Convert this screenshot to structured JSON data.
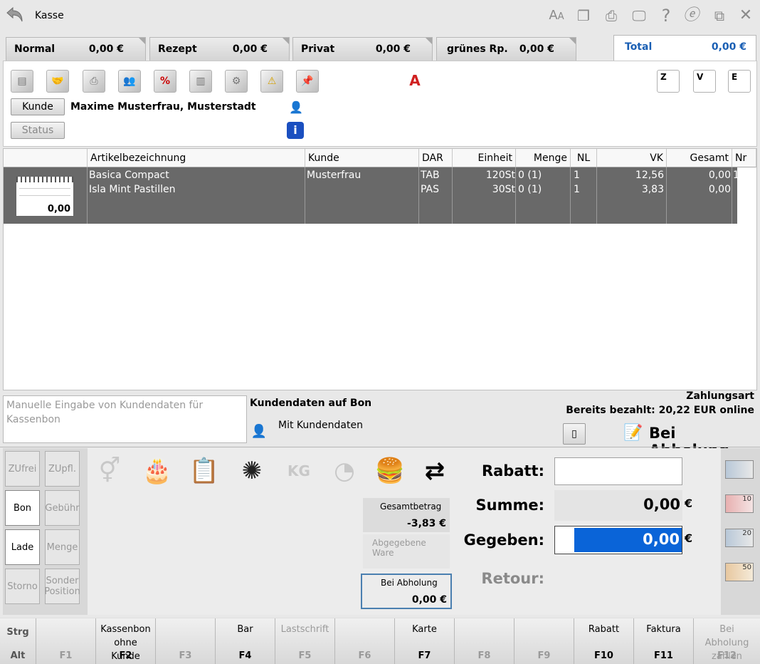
{
  "window": {
    "title": "Kasse"
  },
  "tabs": [
    {
      "label": "Normal",
      "value": "0,00 €"
    },
    {
      "label": "Rezept",
      "value": "0,00 €"
    },
    {
      "label": "Privat",
      "value": "0,00 €"
    },
    {
      "label": "grünes Rp.",
      "value": "0,00 €"
    },
    {
      "label": "Total",
      "value": "0,00 €"
    }
  ],
  "header": {
    "kunde_button": "Kunde",
    "customer_name": "Maxime Musterfrau, Musterstadt",
    "status_button": "Status",
    "right_icons": [
      "Z",
      "V",
      "E"
    ]
  },
  "table": {
    "columns": [
      "Artikelbezeichnung",
      "Kunde",
      "DAR",
      "Einheit",
      "Menge",
      "NL",
      "VK",
      "Gesamt",
      "Nr"
    ],
    "pad_value": "0,00",
    "rows": [
      {
        "name": "Basica Compact",
        "kunde": "Musterfrau",
        "dar": "TAB",
        "einheit": "120St",
        "menge": "0 (1)",
        "nl": "1",
        "vk": "12,56",
        "gesamt": "0,00",
        "nr": "1"
      },
      {
        "name": "Isla Mint Pastillen",
        "kunde": "",
        "dar": "PAS",
        "einheit": "30St",
        "menge": "0 (1)",
        "nl": "1",
        "vk": "3,83",
        "gesamt": "0,00",
        "nr": ""
      }
    ]
  },
  "customer_data": {
    "placeholder": "Manuelle Eingabe von Kundendaten für Kassenbon",
    "heading": "Kundendaten auf Bon",
    "option": "Mit Kundendaten"
  },
  "payment": {
    "heading": "Zahlungsart",
    "paid_info": "Bereits bezahlt: 20,22 EUR online",
    "method": "Bei Abholung"
  },
  "side_buttons": [
    {
      "label": "ZUfrei",
      "active": false
    },
    {
      "label": "ZUpfl.",
      "active": false
    },
    {
      "label": "Bon",
      "active": true
    },
    {
      "label": "Gebühr",
      "active": false
    },
    {
      "label": "Lade",
      "active": true
    },
    {
      "label": "Menge",
      "active": false
    },
    {
      "label": "Storno",
      "active": false
    },
    {
      "label": "Sonder Position",
      "active": false
    }
  ],
  "totals_boxes": {
    "gesamtbetrag_label": "Gesamtbetrag",
    "gesamtbetrag_value": "-3,83 €",
    "abgegeben_label": "Abgegebene Ware",
    "abholung_label": "Bei Abholung",
    "abholung_value": "0,00 €"
  },
  "summary": {
    "rabatt_label": "Rabatt:",
    "summe_label": "Summe:",
    "summe_value": "0,00",
    "gegeben_label": "Gegeben:",
    "gegeben_value": "0,00",
    "retour_label": "Retour:",
    "currency": "€"
  },
  "money_buttons": [
    "",
    "10",
    "20",
    "50"
  ],
  "function_keys": {
    "strg": "Strg",
    "alt": "Alt",
    "keys": [
      {
        "key": "F1",
        "label": "",
        "enabled": false
      },
      {
        "key": "F2",
        "label": "Kassenbon ohne Kunde",
        "enabled": true
      },
      {
        "key": "F3",
        "label": "",
        "enabled": false
      },
      {
        "key": "F4",
        "label": "Bar",
        "enabled": true
      },
      {
        "key": "F5",
        "label": "Lastschrift",
        "enabled": false
      },
      {
        "key": "F6",
        "label": "",
        "enabled": false
      },
      {
        "key": "F7",
        "label": "Karte",
        "enabled": true
      },
      {
        "key": "F8",
        "label": "",
        "enabled": false
      },
      {
        "key": "F9",
        "label": "",
        "enabled": false
      },
      {
        "key": "F10",
        "label": "Rabatt",
        "enabled": true
      },
      {
        "key": "F11",
        "label": "Faktura",
        "enabled": true
      },
      {
        "key": "F12",
        "label": "Bei Abholung zahlen",
        "enabled": false
      }
    ]
  },
  "colors": {
    "accent": "#1a5fb4",
    "selected_row": "#696969",
    "input_highlight": "#0a64d8"
  }
}
